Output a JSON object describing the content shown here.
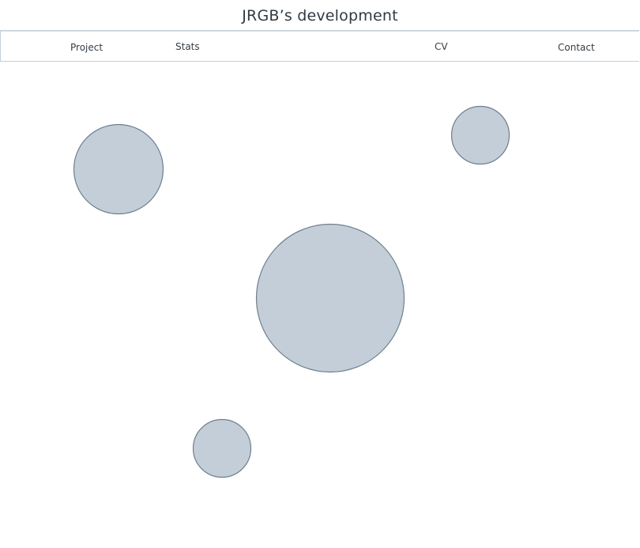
{
  "header": {
    "title": "JRGB’s development"
  },
  "nav": {
    "items": [
      {
        "label": "Project"
      },
      {
        "label": "Stats"
      },
      {
        "label": "CV"
      },
      {
        "label": "Contact"
      }
    ]
  },
  "bubbles": {
    "count": 4,
    "fill_color": "#c3ced8",
    "stroke_color": "#6e7f8f"
  }
}
